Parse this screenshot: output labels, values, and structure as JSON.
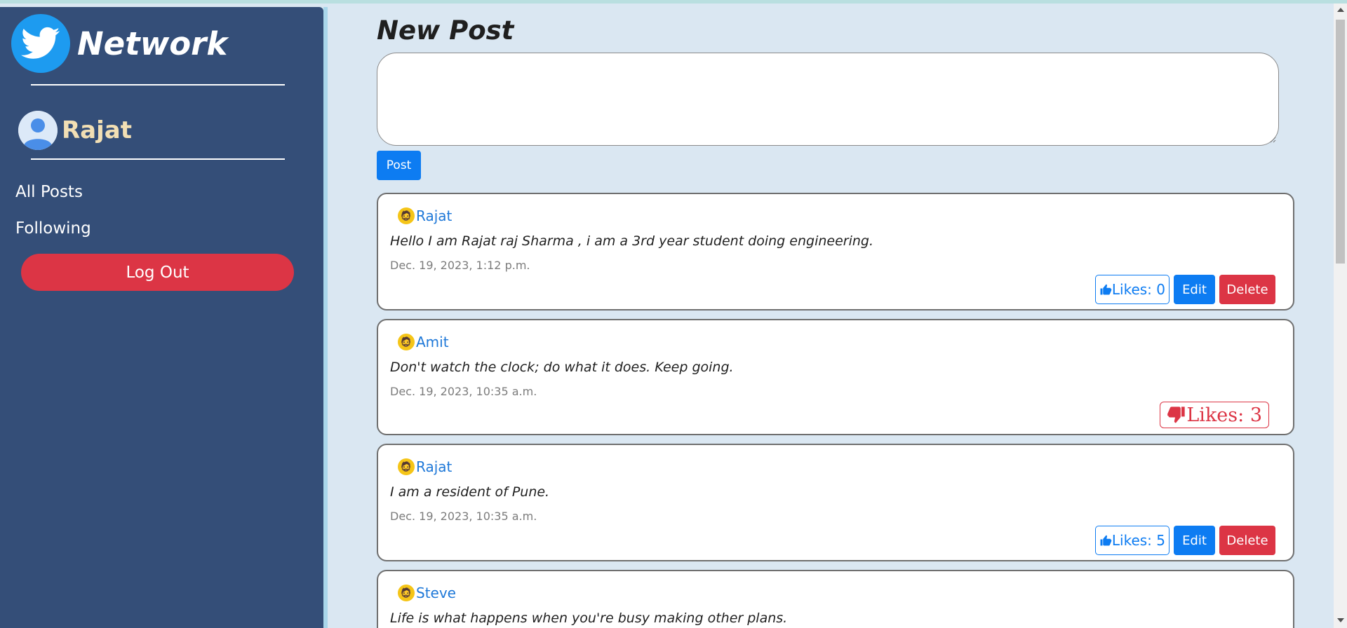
{
  "sidebar": {
    "brand": "Network",
    "username": "Rajat",
    "nav": [
      "All Posts",
      "Following"
    ],
    "logout_label": "Log Out"
  },
  "composer": {
    "title": "New Post",
    "textarea_value": "",
    "post_label": "Post"
  },
  "posts": [
    {
      "author": "Rajat",
      "content": "Hello I am Rajat raj Sharma , i am a 3rd year student doing engineering.",
      "timestamp": "Dec. 19, 2023, 1:12 p.m.",
      "likes_label": "Likes: 0",
      "edit_label": "Edit",
      "delete_label": "Delete"
    },
    {
      "author": "Amit",
      "content": "Don't watch the clock; do what it does. Keep going.",
      "timestamp": "Dec. 19, 2023, 10:35 a.m.",
      "likes_label": "Likes: 3"
    },
    {
      "author": "Rajat",
      "content": "I am a resident of Pune.",
      "timestamp": "Dec. 19, 2023, 10:35 a.m.",
      "likes_label": "Likes: 5",
      "edit_label": "Edit",
      "delete_label": "Delete"
    },
    {
      "author": "Steve",
      "content": "Life is what happens when you're busy making other plans."
    }
  ],
  "colors": {
    "sidebar": "#344e78",
    "primary": "#0d7cf2",
    "danger": "#dc3545",
    "background": "#dae7f2"
  }
}
